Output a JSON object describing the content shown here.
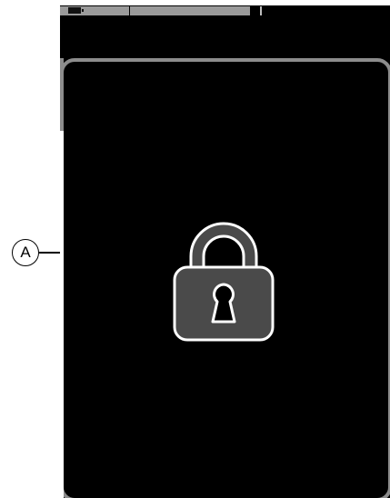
{
  "device": {
    "status_bar": {
      "battery": "battery-icon"
    },
    "lock_screen": {
      "icon": "padlock-icon"
    }
  },
  "annotations": {
    "callout_label": "A"
  },
  "colors": {
    "screen": "#000000",
    "panel_border": "#8c8c8c",
    "padlock_fill": "#4a4a4a",
    "padlock_outline": "#ffffff"
  }
}
